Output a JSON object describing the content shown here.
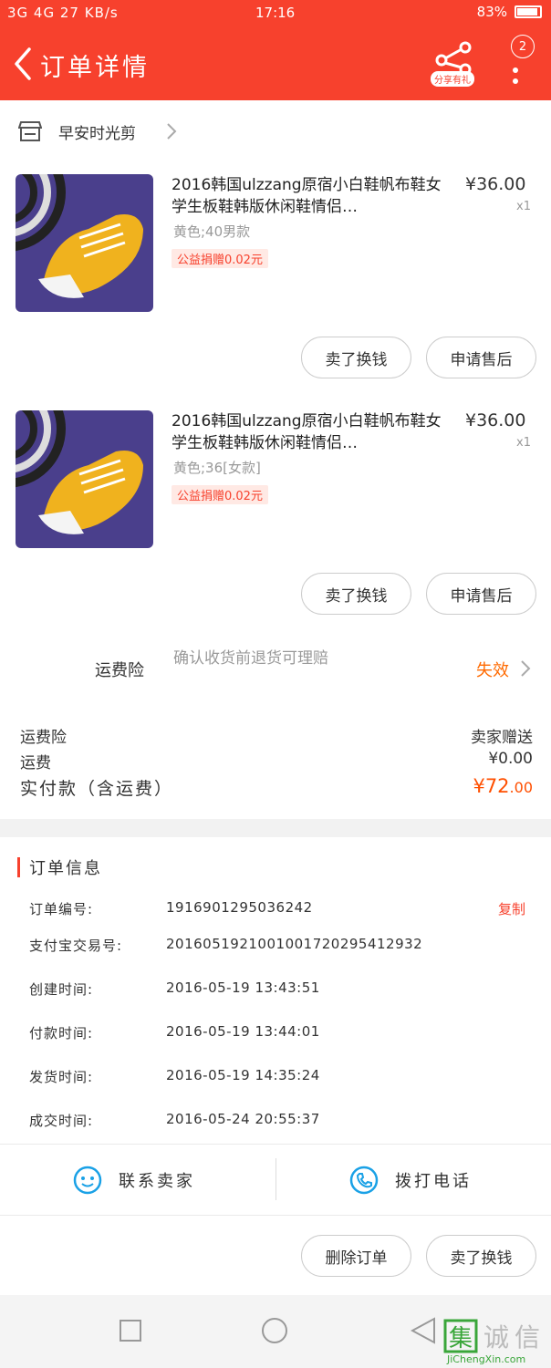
{
  "status_bar": {
    "network": "3G 4G",
    "speed": "27 KB/s",
    "time": "17:16",
    "battery": "83%"
  },
  "header": {
    "title": "订单详情",
    "share_label": "分享有礼",
    "badge_count": "2"
  },
  "shop": {
    "name": "早安时光剪"
  },
  "items": [
    {
      "title": "2016韩国ulzzang原宿小白鞋帆布鞋女学生板鞋韩版休闲鞋情侣…",
      "price": "¥36.00",
      "qty": "x1",
      "spec": "黄色;40男款",
      "tag": "公益捐赠0.02元",
      "btn_sell": "卖了换钱",
      "btn_after": "申请售后"
    },
    {
      "title": "2016韩国ulzzang原宿小白鞋帆布鞋女学生板鞋韩版休闲鞋情侣…",
      "price": "¥36.00",
      "qty": "x1",
      "spec": "黄色;36[女款]",
      "tag": "公益捐赠0.02元",
      "btn_sell": "卖了换钱",
      "btn_after": "申请售后"
    }
  ],
  "insurance": {
    "label": "运费险",
    "desc": "确认收货前退货可理赔",
    "status": "失效"
  },
  "summary": {
    "insurance_label": "运费险",
    "insurance_value": "卖家赠送",
    "shipping_label": "运费",
    "shipping_value": "¥0.00",
    "total_label": "实付款（含运费）",
    "total_currency": "¥",
    "total_int": "72",
    "total_dec": ".00"
  },
  "order_info": {
    "title": "订单信息",
    "copy_label": "复制",
    "rows": [
      {
        "key": "订单编号:",
        "value": "1916901295036242"
      },
      {
        "key": "支付宝交易号:",
        "value": "2016051921001001720295412932"
      },
      {
        "key": "创建时间:",
        "value": "2016-05-19 13:43:51"
      },
      {
        "key": "付款时间:",
        "value": "2016-05-19 13:44:01"
      },
      {
        "key": "发货时间:",
        "value": "2016-05-19 14:35:24"
      },
      {
        "key": "成交时间:",
        "value": "2016-05-24 20:55:37"
      }
    ]
  },
  "contact": {
    "seller_label": "联系卖家",
    "call_label": "拨打电话"
  },
  "bottom_actions": {
    "delete_label": "删除订单",
    "sell_label": "卖了换钱"
  },
  "watermark": {
    "brand": "集诚信",
    "url": "JiChengXin.com"
  },
  "colors": {
    "header_red": "#f7412d",
    "accent_orange": "#ff6a00"
  }
}
